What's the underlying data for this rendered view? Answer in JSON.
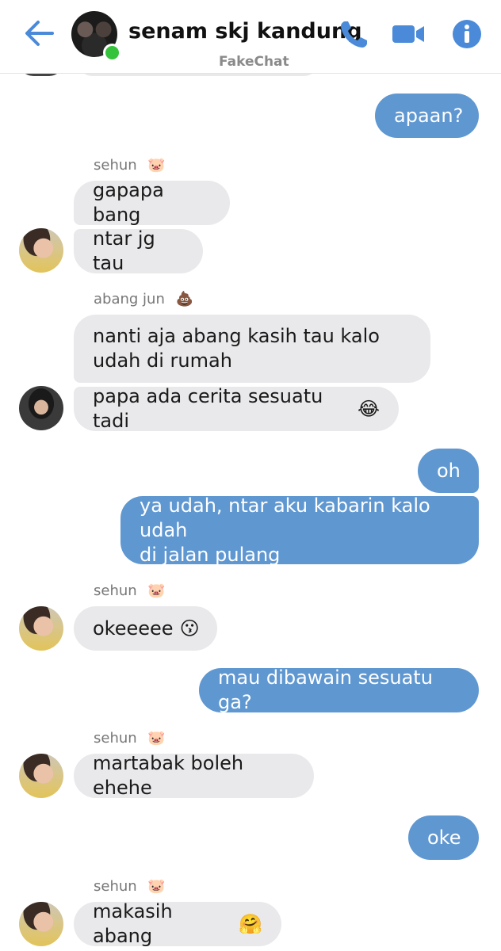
{
  "header": {
    "title": "senam skj kandung",
    "subtitle": "FakeChat",
    "online_color": "#35c33b",
    "accent_color": "#4a8ad8",
    "icons": [
      "back-arrow-icon",
      "phone-icon",
      "video-camera-icon",
      "info-icon"
    ]
  },
  "messages": [
    {
      "dir": "out",
      "text": "apaan?"
    },
    {
      "sender": "sehun",
      "sender_emoji": "🐷"
    },
    {
      "dir": "in",
      "text": "gapapa bang"
    },
    {
      "dir": "in",
      "text": "ntar jg tau"
    },
    {
      "sender": "abang jun",
      "sender_emoji": "💩"
    },
    {
      "dir": "in",
      "text": "nanti aja abang kasih tau kalo\nudah di rumah"
    },
    {
      "dir": "in",
      "text": "papa ada cerita sesuatu tadi",
      "emoji": "😂"
    },
    {
      "dir": "out",
      "text": "oh"
    },
    {
      "dir": "out",
      "text": "ya udah, ntar aku kabarin kalo udah\ndi jalan pulang"
    },
    {
      "sender": "sehun",
      "sender_emoji": "🐷"
    },
    {
      "dir": "in",
      "text": "okeeeee",
      "emoji": "😗"
    },
    {
      "dir": "out",
      "text": "mau dibawain sesuatu ga?"
    },
    {
      "sender": "sehun",
      "sender_emoji": "🐷"
    },
    {
      "dir": "in",
      "text": "martabak boleh ehehe"
    },
    {
      "dir": "out",
      "text": "oke"
    },
    {
      "sender": "sehun",
      "sender_emoji": "🐷"
    },
    {
      "dir": "in",
      "text": "makasih abang",
      "emoji": "🤗"
    }
  ],
  "colors": {
    "incoming_bubble": "#e9e9eb",
    "outgoing_bubble": "#5f97d1"
  }
}
